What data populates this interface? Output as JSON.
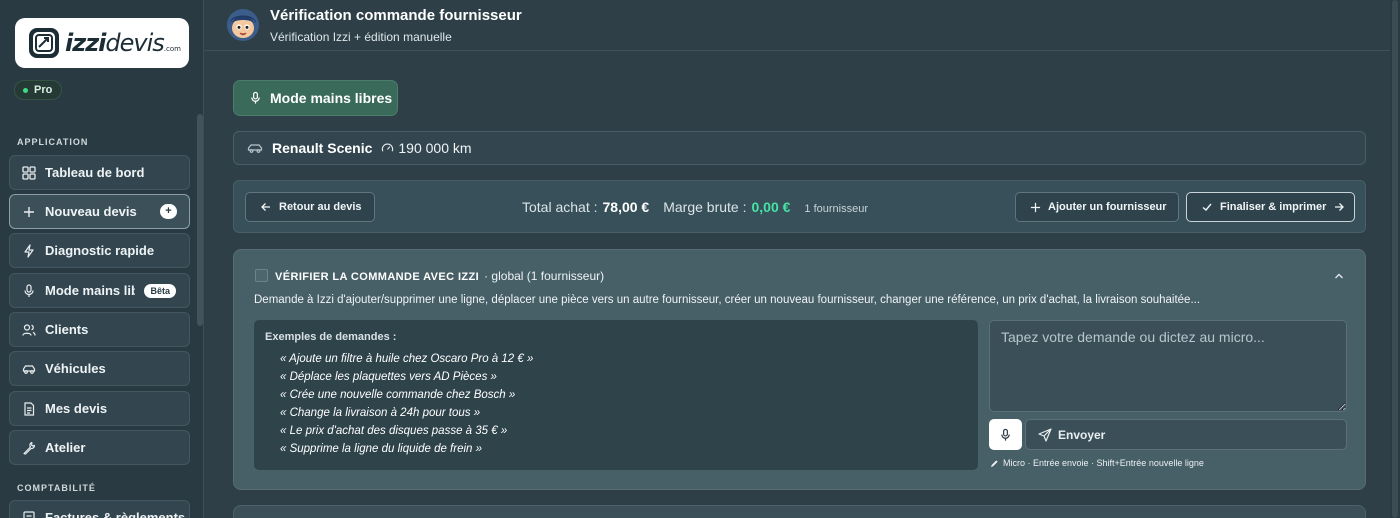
{
  "brand": {
    "logo_main": "izzi",
    "logo_rest": "devis",
    "logo_suffix": ".com",
    "plan_badge": "Pro"
  },
  "sidebar": {
    "section_application": "APPLICATION",
    "section_comptabilite": "COMPTABILITÉ",
    "items": [
      {
        "label": "Tableau de bord",
        "icon": "dashboard-icon"
      },
      {
        "label": "Nouveau devis",
        "icon": "plus-icon",
        "badge": "+"
      },
      {
        "label": "Diagnostic rapide",
        "icon": "lightning-icon"
      },
      {
        "label": "Mode mains libres",
        "icon": "microphone-icon",
        "badge": "Bêta"
      },
      {
        "label": "Clients",
        "icon": "users-icon"
      },
      {
        "label": "Véhicules",
        "icon": "car-icon"
      },
      {
        "label": "Mes devis",
        "icon": "document-icon"
      },
      {
        "label": "Atelier",
        "icon": "wrench-icon"
      },
      {
        "label": "Factures & règlements",
        "icon": "invoice-icon"
      }
    ]
  },
  "header": {
    "title": "Vérification commande fournisseur",
    "subtitle": "Vérification Izzi + édition manuelle"
  },
  "hands_free_button": "Mode mains libres",
  "vehicle": {
    "name": "Renault Scenic",
    "mileage": "190 000 km"
  },
  "toolbar": {
    "back_label": "Retour au devis",
    "total_label": "Total achat :",
    "total_value": "78,00 €",
    "margin_label": "Marge brute :",
    "margin_value": "0,00 €",
    "supplier_count": "1 fournisseur",
    "add_supplier_label": "Ajouter un fournisseur",
    "finalize_label": "Finaliser & imprimer"
  },
  "verify": {
    "title": "VÉRIFIER LA COMMANDE AVEC IZZI",
    "scope": "· global (1 fournisseur)",
    "description": "Demande à Izzi d'ajouter/supprimer une ligne, déplacer une pièce vers un autre fournisseur, créer un nouveau fournisseur, changer une référence, un prix d'achat, la livraison souhaitée...",
    "examples_title": "Exemples de demandes :",
    "examples": [
      "« Ajoute un filtre à huile chez Oscaro Pro à 12 € »",
      "« Déplace les plaquettes vers AD Pièces »",
      "« Crée une nouvelle commande chez Bosch »",
      "« Change la livraison à 24h pour tous »",
      "« Le prix d'achat des disques passe à 35 € »",
      "« Supprime la ligne du liquide de frein »"
    ],
    "input_placeholder": "Tapez votre demande ou dictez au micro...",
    "input_value": "",
    "send_label": "Envoyer",
    "hint": "Micro · Entrée envoie · Shift+Entrée nouvelle ligne"
  },
  "colors": {
    "accent_green": "#47e2a6",
    "hands_free_bg": "#3a6a5a",
    "sidebar_bg": "#2a3a42"
  }
}
